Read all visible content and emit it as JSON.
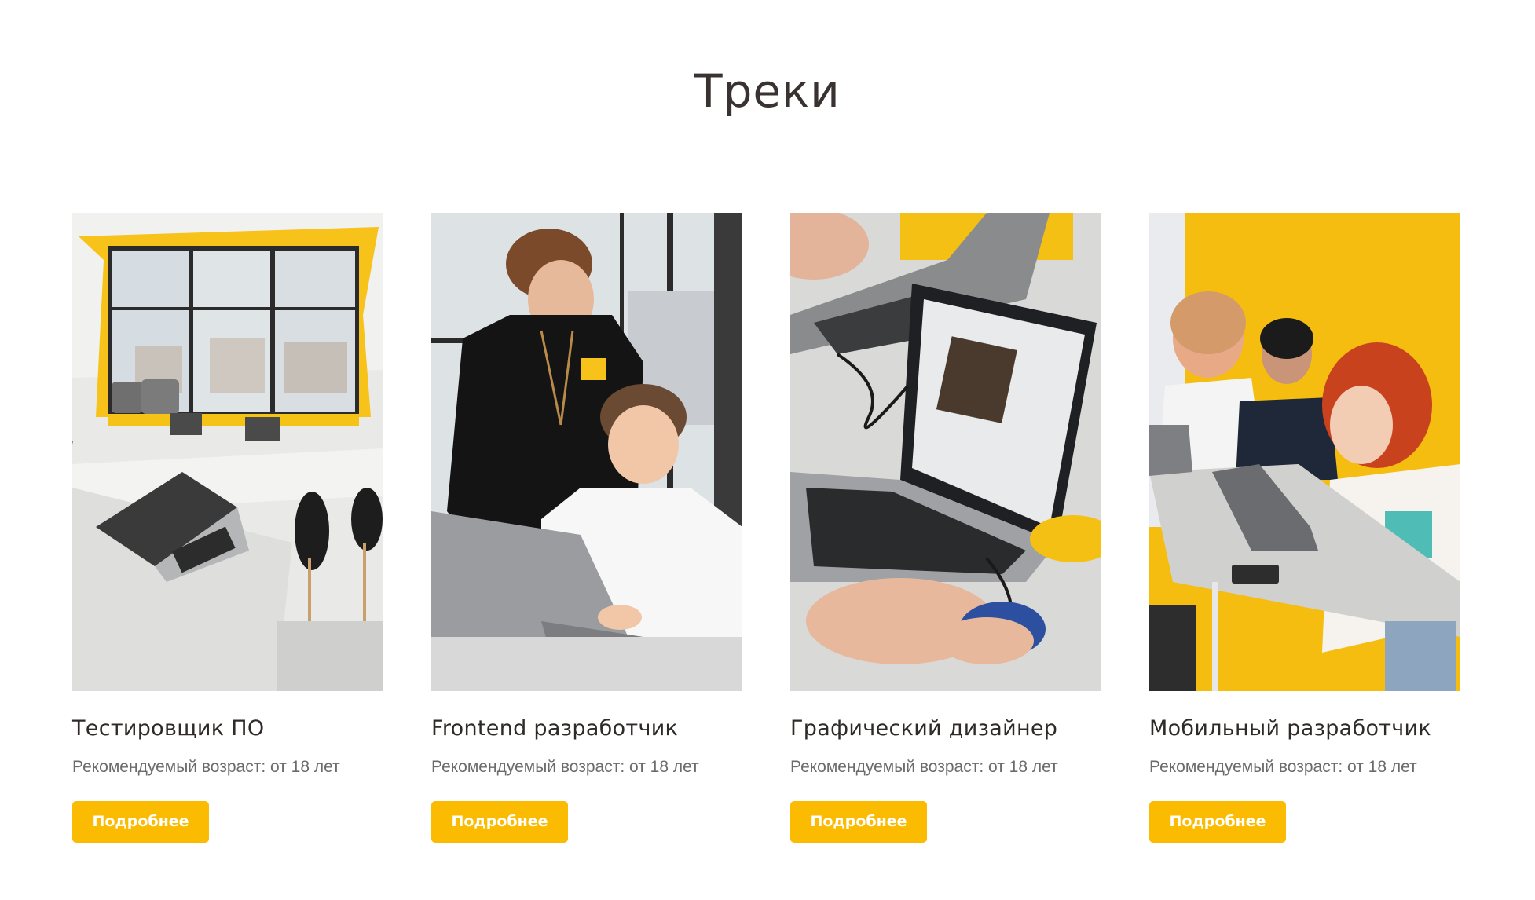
{
  "section": {
    "title": "Треки"
  },
  "cards": [
    {
      "title": "Тестировщик ПО",
      "subtitle": "Рекомендуемый возраст: от 18 лет",
      "button_label": "Подробнее",
      "image_description": "classroom-with-laptops-photo"
    },
    {
      "title": "Frontend разработчик",
      "subtitle": "Рекомендуемый возраст: от 18 лет",
      "button_label": "Подробнее",
      "image_description": "teacher-and-boy-at-laptop-photo"
    },
    {
      "title": "Графический дизайнер",
      "subtitle": "Рекомендуемый возраст: от 18 лет",
      "button_label": "Подробнее",
      "image_description": "laptop-with-design-app-photo"
    },
    {
      "title": "Мобильный разработчик",
      "subtitle": "Рекомендуемый возраст: от 18 лет",
      "button_label": "Подробнее",
      "image_description": "students-at-laptops-photo"
    }
  ],
  "colors": {
    "accent": "#fbbb00",
    "title": "#3a3230",
    "subtitle": "#6b6b6b"
  }
}
